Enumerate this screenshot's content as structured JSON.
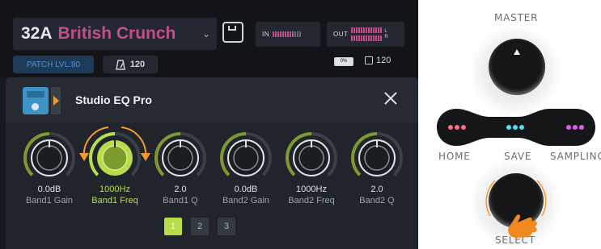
{
  "header": {
    "patch_number": "32A",
    "patch_name": "British Crunch",
    "input_meter_label": "IN",
    "output_meter_label": "OUT",
    "output_channel_left": "L",
    "output_channel_right": "R",
    "patch_level": "PATCH LVL:80",
    "tempo": "120",
    "battery": "0%",
    "cpu": "120"
  },
  "effect": {
    "name": "Studio EQ Pro",
    "knobs": [
      {
        "value": "0.0dB",
        "label": "Band1 Gain",
        "level": 0.5,
        "selected": false
      },
      {
        "value": "1000Hz",
        "label": "Band1 Freq",
        "level": 0.5,
        "selected": true
      },
      {
        "value": "2.0",
        "label": "Band1 Q",
        "level": 0.5,
        "selected": false
      },
      {
        "value": "0.0dB",
        "label": "Band2 Gain",
        "level": 0.5,
        "selected": false
      },
      {
        "value": "1000Hz",
        "label": "Band2 Freq",
        "level": 0.5,
        "selected": false
      },
      {
        "value": "2.0",
        "label": "Band2 Q",
        "level": 0.5,
        "selected": false
      }
    ],
    "pages": [
      "1",
      "2",
      "3"
    ],
    "active_page": "1"
  },
  "controller": {
    "master_label": "MASTER",
    "home_label": "HOME",
    "save_label": "SAVE",
    "sampling_label": "SAMPLING",
    "select_label": "SELECT"
  },
  "colors": {
    "accent_green": "#b8dc4a",
    "patch_name_pink": "#c24f87",
    "home_led": "#ff6b86",
    "save_led": "#4fe3f0",
    "sampling_led": "#e05cf0",
    "turn_arrow_orange": "#f49b2b"
  },
  "icons": [
    "save-icon",
    "metronome-icon",
    "battery-icon",
    "cpu-icon",
    "close-icon",
    "chevron-down-icon",
    "hand-pointer-icon"
  ]
}
